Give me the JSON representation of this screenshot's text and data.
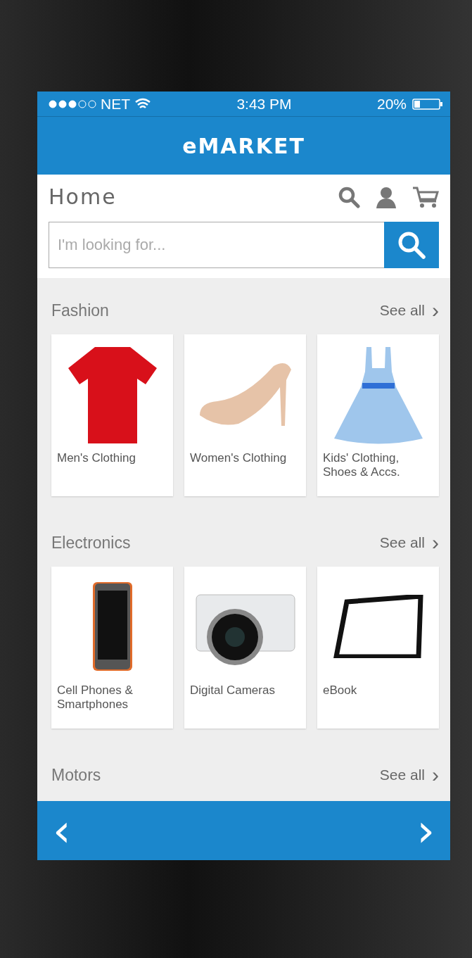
{
  "status_bar": {
    "carrier": "NET",
    "time": "3:43 PM",
    "battery": "20%"
  },
  "app_bar": {
    "title": "eMARKET"
  },
  "page": {
    "title": "Home"
  },
  "search": {
    "placeholder": "I'm looking for..."
  },
  "sections": [
    {
      "title": "Fashion",
      "see_all": "See all",
      "chevron": "›",
      "items": [
        {
          "label": "Men's Clothing",
          "kind": "tshirt"
        },
        {
          "label": "Women's Clothing",
          "kind": "shoe"
        },
        {
          "label": "Kids' Clothing, Shoes & Accs.",
          "kind": "dress"
        }
      ]
    },
    {
      "title": "Electronics",
      "see_all": "See all",
      "chevron": "›",
      "items": [
        {
          "label": "Cell Phones & Smartphones",
          "kind": "phone"
        },
        {
          "label": "Digital Cameras",
          "kind": "camera"
        },
        {
          "label": "eBook",
          "kind": "tablet"
        }
      ]
    },
    {
      "title": "Motors",
      "see_all": "See all",
      "chevron": "›"
    }
  ],
  "nav": {
    "prev": "‹",
    "next": "›"
  }
}
